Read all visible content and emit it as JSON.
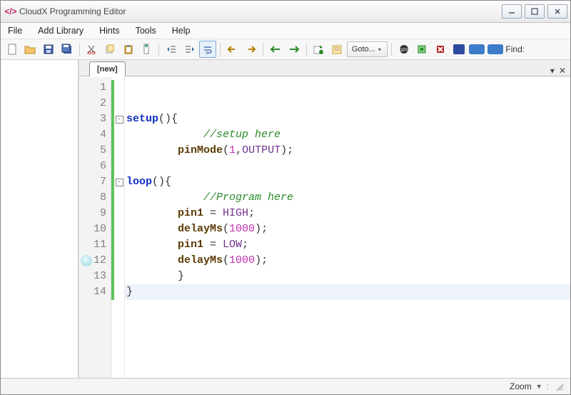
{
  "window": {
    "title": "CloudX Programming Editor"
  },
  "menubar": {
    "items": [
      "File",
      "Add Library",
      "Hints",
      "Tools",
      "Help"
    ]
  },
  "toolbar": {
    "goto_label": "Goto...",
    "find_label": "Find:"
  },
  "tabs": {
    "active": "[new]"
  },
  "editor": {
    "current_line": 14,
    "lines": [
      {
        "n": 1,
        "fold": "",
        "changed": true,
        "tokens": []
      },
      {
        "n": 2,
        "fold": "",
        "changed": true,
        "tokens": []
      },
      {
        "n": 3,
        "fold": "-",
        "changed": true,
        "tokens": [
          [
            "kw",
            "setup"
          ],
          [
            "punc",
            "(){"
          ]
        ]
      },
      {
        "n": 4,
        "fold": "",
        "changed": true,
        "tokens": [
          [
            "text",
            "            "
          ],
          [
            "comment",
            "//setup here"
          ]
        ]
      },
      {
        "n": 5,
        "fold": "",
        "changed": true,
        "tokens": [
          [
            "text",
            "        "
          ],
          [
            "fn",
            "pinMode"
          ],
          [
            "punc",
            "("
          ],
          [
            "num",
            "1"
          ],
          [
            "punc",
            ","
          ],
          [
            "const",
            "OUTPUT"
          ],
          [
            "punc",
            ");"
          ]
        ]
      },
      {
        "n": 6,
        "fold": "",
        "changed": true,
        "tokens": []
      },
      {
        "n": 7,
        "fold": "-",
        "changed": true,
        "tokens": [
          [
            "kw",
            "loop"
          ],
          [
            "punc",
            "(){"
          ]
        ]
      },
      {
        "n": 8,
        "fold": "",
        "changed": true,
        "tokens": [
          [
            "text",
            "            "
          ],
          [
            "comment",
            "//Program here"
          ]
        ]
      },
      {
        "n": 9,
        "fold": "",
        "changed": true,
        "tokens": [
          [
            "text",
            "        "
          ],
          [
            "fn",
            "pin1"
          ],
          [
            "punc",
            " = "
          ],
          [
            "const",
            "HIGH"
          ],
          [
            "punc",
            ";"
          ]
        ]
      },
      {
        "n": 10,
        "fold": "",
        "changed": true,
        "tokens": [
          [
            "text",
            "        "
          ],
          [
            "fn",
            "delayMs"
          ],
          [
            "punc",
            "("
          ],
          [
            "num",
            "1000"
          ],
          [
            "punc",
            ");"
          ]
        ]
      },
      {
        "n": 11,
        "fold": "",
        "changed": true,
        "tokens": [
          [
            "text",
            "        "
          ],
          [
            "fn",
            "pin1"
          ],
          [
            "punc",
            " = "
          ],
          [
            "const",
            "LOW"
          ],
          [
            "punc",
            ";"
          ]
        ]
      },
      {
        "n": 12,
        "fold": "",
        "changed": true,
        "bookmark": true,
        "tokens": [
          [
            "text",
            "        "
          ],
          [
            "fn",
            "delayMs"
          ],
          [
            "punc",
            "("
          ],
          [
            "num",
            "1000"
          ],
          [
            "punc",
            ");"
          ]
        ]
      },
      {
        "n": 13,
        "fold": "",
        "changed": true,
        "tokens": [
          [
            "text",
            "        "
          ],
          [
            "punc",
            "}"
          ]
        ]
      },
      {
        "n": 14,
        "fold": "",
        "changed": true,
        "tokens": [
          [
            "punc",
            "}"
          ]
        ]
      }
    ]
  },
  "statusbar": {
    "zoom_label": "Zoom"
  }
}
